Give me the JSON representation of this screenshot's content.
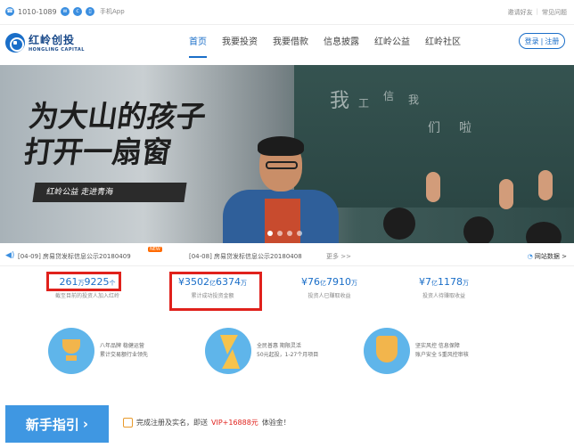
{
  "topbar": {
    "phone": "1010-1089",
    "app_label": "手机App",
    "invite_label": "邀请好友",
    "faq_label": "常见问题"
  },
  "header": {
    "logo_cn": "红岭创投",
    "logo_en": "HONGLING CAPITAL",
    "nav": [
      {
        "label": "首页"
      },
      {
        "label": "我要投资"
      },
      {
        "label": "我要借款"
      },
      {
        "label": "信息披露"
      },
      {
        "label": "红岭公益"
      },
      {
        "label": "红岭社区"
      }
    ],
    "login_label": "登录",
    "register_label": "注册"
  },
  "banner": {
    "slogan_line1": "为大山的孩子",
    "slogan_line2": "打开一扇窗",
    "subslogan": "红岭公益  走进青海"
  },
  "notices": {
    "item1": "[04-09] 房易贷发标信息公示20180409",
    "badge": "NEW",
    "item2": "[04-08] 房易贷发标信息公示20180408",
    "more": "更多 >>",
    "data_link": "网站数据 >"
  },
  "stats": [
    {
      "value": "261",
      "unit1": "万",
      "value2": "9225",
      "unit2": "个",
      "label": "截至目前已有超过XX名投资人加入红岭"
    },
    {
      "value": "¥3502",
      "unit1": "亿",
      "value2": "6374",
      "unit2": "万",
      "label": "累计成功投资金额"
    },
    {
      "value": "¥76",
      "unit1": "亿",
      "value2": "7910",
      "unit2": "万",
      "label": "投资人已赚取收益"
    },
    {
      "value": "¥7",
      "unit1": "亿",
      "value2": "1178",
      "unit2": "万",
      "label": "投资人待赚取收益"
    }
  ],
  "features": [
    {
      "line1": "八年品牌 稳健运营",
      "line2": "累计交易额行业领先"
    },
    {
      "line1": "全民普惠 期限灵活",
      "line2": "50元起投，1-27个月项目"
    },
    {
      "line1": "坚实风控 信息保障",
      "line2": "账户安全 5重风控审核"
    }
  ],
  "guide": {
    "label": "新手指引",
    "arrow": "›"
  },
  "promo": {
    "prefix": "完成注册及实名，即送",
    "highlight": "VIP+16888元",
    "suffix": "体验金！"
  },
  "colors": {
    "brand": "#1a6ec8",
    "highlight_box": "#e0211c"
  }
}
